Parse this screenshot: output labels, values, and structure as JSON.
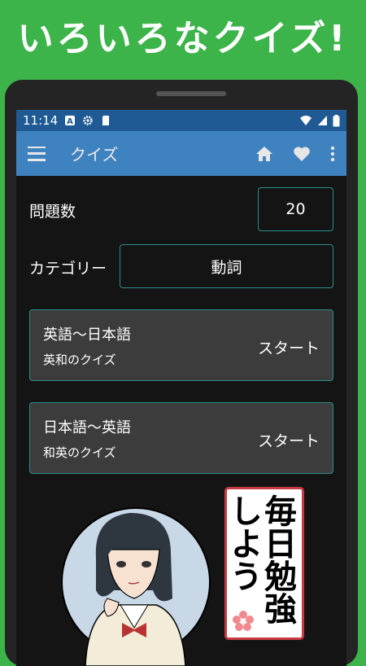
{
  "promo": {
    "title": "いろいろなクイズ!"
  },
  "status": {
    "time": "11:14"
  },
  "appbar": {
    "title": "クイズ"
  },
  "settings": {
    "question_count_label": "問題数",
    "question_count_value": "20",
    "category_label": "カテゴリー",
    "category_value": "動詞"
  },
  "cards": [
    {
      "title": "英語〜日本語",
      "subtitle": "英和のクイズ",
      "action": "スタート"
    },
    {
      "title": "日本語〜英語",
      "subtitle": "和英のクイズ",
      "action": "スタート"
    }
  ],
  "sign": {
    "col1": "毎日勉強",
    "col2": "しよう"
  },
  "colors": {
    "background": "#3cb44a",
    "appbar": "#3f82c0",
    "statusbar": "#1f5a95",
    "accent_border": "#2d8c8c",
    "card": "#3c3c3c",
    "sign_border": "#c73a44"
  },
  "icons": [
    "a-icon",
    "gear-icon",
    "sd-card-icon",
    "wifi-icon",
    "signal-icon",
    "battery-icon",
    "menu-icon",
    "home-icon",
    "heart-icon",
    "more-vert-icon",
    "sakura-icon"
  ]
}
